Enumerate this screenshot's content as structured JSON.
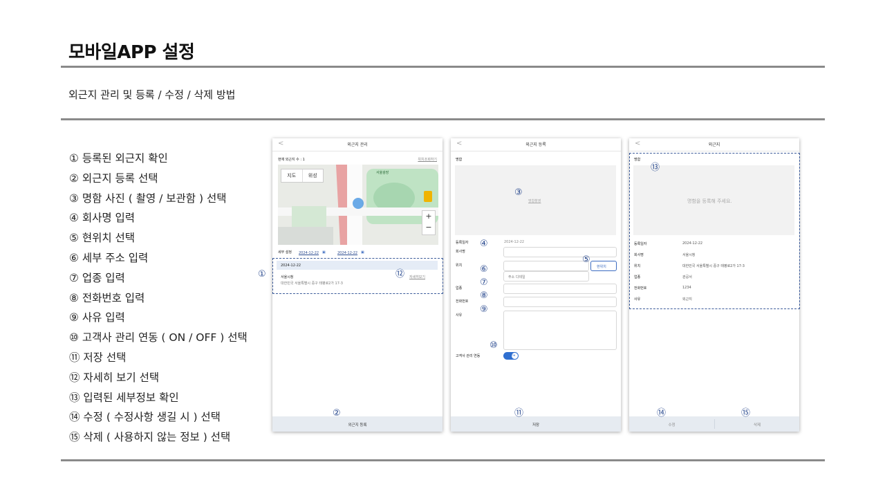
{
  "header": {
    "title": "모바일APP 설정",
    "subtitle": "외근지 관리 및 등록 / 수정 / 삭제 방법"
  },
  "steps": [
    "① 등록된 외근지 확인",
    "② 외근지 등록 선택",
    "③ 명함 사진 ( 촬영 / 보관함 ) 선택",
    "④ 회사명 입력",
    "⑤ 현위치 선택",
    "⑥ 세부 주소 입력",
    "⑦ 업종 입력",
    "⑧ 전화번호 입력",
    "⑨ 사유 입력",
    "⑩ 고객사 관리 연동 ( ON / OFF ) 선택",
    "⑪ 저장 선택",
    "⑫ 자세히 보기 선택",
    "⑬ 입력된 세부정보 확인",
    "⑭ 수정 ( 수정사항 생길 시 ) 선택",
    "⑮ 삭제 ( 사용하지 않는 정보 ) 선택"
  ],
  "markers": {
    "m1": "①",
    "m2": "②",
    "m3": "③",
    "m4": "④",
    "m5": "⑤",
    "m6": "⑥",
    "m7": "⑦",
    "m8": "⑧",
    "m9": "⑨",
    "m10": "⑩",
    "m11": "⑪",
    "m12": "⑫",
    "m13": "⑬",
    "m14": "⑭",
    "m15": "⑮"
  },
  "screen1": {
    "back": "<",
    "title": "외근지 관리",
    "count_label": "현재 외근지 수 : 1",
    "refresh": "위치조회하기",
    "map_tab": "지도",
    "sat_tab": "위성",
    "zoom_in": "+",
    "zoom_out": "−",
    "map_place": "서울광장",
    "date_label": "세부 설정",
    "date_from": "2024-12-22",
    "date_to": "2024-12-22",
    "card_date": "2024-12-22",
    "card_name": "서울시청",
    "card_addr": "대한민국 서울특별시 중구 태평로2가 17-3",
    "card_detail": "자세히보기",
    "bottom": "외근지 등록"
  },
  "screen2": {
    "back": "<",
    "title": "외근지 등록",
    "card_label": "명함",
    "photo_hint": "명함촬영",
    "date_label": "등록일자",
    "date_value": "2024-12-22",
    "company_label": "회사명",
    "location_label": "위치",
    "loc_btn": "현위치",
    "detail_placeholder": "주소 디테일",
    "biz_label": "업종",
    "phone_label": "전화번호",
    "reason_label": "사유",
    "sync_label": "고객사 관리 연동",
    "toggle": "ON",
    "bottom": "저장"
  },
  "screen3": {
    "back": "<",
    "title": "외근지",
    "card_label": "명함",
    "card_empty": "명함을 등록해 주세요.",
    "rows": [
      {
        "label": "등록일자",
        "value": "2024-12-22"
      },
      {
        "label": "회사명",
        "value": "서울시청"
      },
      {
        "label": "위치",
        "value": "대한민국 서울특별시 중구 태평로2가 17-3"
      },
      {
        "label": "업종",
        "value": "관공서"
      },
      {
        "label": "전화번호",
        "value": "1234"
      },
      {
        "label": "사유",
        "value": "외근지"
      }
    ],
    "edit": "수정",
    "delete": "삭제"
  }
}
